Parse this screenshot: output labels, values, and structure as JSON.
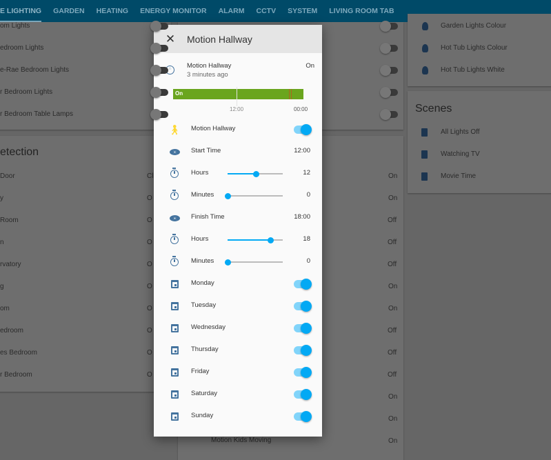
{
  "tabs": [
    "E LIGHTING",
    "GARDEN",
    "HEATING",
    "ENERGY MONITOR",
    "ALARM",
    "CCTV",
    "SYSTEM",
    "LIVING ROOM TAB"
  ],
  "left_card_lights": [
    "om Lights",
    "edroom Lights",
    "e-Rae Bedroom Lights",
    "r Bedroom Lights",
    "r Bedroom Table Lamps"
  ],
  "detection": {
    "title": "etection",
    "items": [
      {
        "name": "Door",
        "state": "Cl"
      },
      {
        "name": "y",
        "state": "O"
      },
      {
        "name": "Room",
        "state": "O"
      },
      {
        "name": "n",
        "state": "O"
      },
      {
        "name": "rvatory",
        "state": "O"
      },
      {
        "name": "g",
        "state": "O"
      },
      {
        "name": "om",
        "state": "O"
      },
      {
        "name": "edroom",
        "state": "O"
      },
      {
        "name": "es Bedroom",
        "state": "O"
      },
      {
        "name": "r Bedroom",
        "state": "O"
      }
    ]
  },
  "middle_states": [
    "On",
    "On",
    "Off",
    "Off",
    "Off",
    "On",
    "On",
    "Off",
    "Off",
    "Off",
    "On",
    "On"
  ],
  "middle_last": {
    "name": "Motion Kids Moving",
    "state": "On"
  },
  "right_lights": [
    "Garden Lights Colour",
    "Hot Tub Lights Colour",
    "Hot Tub Lights White"
  ],
  "scenes": {
    "title": "Scenes",
    "items": [
      "All Lights Off",
      "Watching TV",
      "Movie Time"
    ]
  },
  "dialog": {
    "title": "Motion Hallway",
    "entity": {
      "name": "Motion Hallway",
      "time": "3 minutes ago",
      "state": "On"
    },
    "history": {
      "bar_label": "On",
      "ticks": [
        "12:00",
        "00:00"
      ],
      "on_color": "#6aa51e"
    },
    "rows": [
      {
        "icon": "walk-icon",
        "label": "Motion Hallway",
        "type": "toggle",
        "on": true
      },
      {
        "icon": "eye-icon",
        "label": "Start Time",
        "type": "value",
        "value": "12:00"
      },
      {
        "icon": "timer-icon",
        "label": "Hours",
        "type": "slider",
        "value": "12",
        "fraction": 0.52
      },
      {
        "icon": "timer-icon",
        "label": "Minutes",
        "type": "slider",
        "value": "0",
        "fraction": 0
      },
      {
        "icon": "eye-icon",
        "label": "Finish Time",
        "type": "value",
        "value": "18:00"
      },
      {
        "icon": "timer-icon",
        "label": "Hours",
        "type": "slider",
        "value": "18",
        "fraction": 0.78
      },
      {
        "icon": "timer-icon",
        "label": "Minutes",
        "type": "slider",
        "value": "0",
        "fraction": 0
      },
      {
        "icon": "calendar-icon",
        "label": "Monday",
        "type": "toggle",
        "on": true
      },
      {
        "icon": "calendar-icon",
        "label": "Tuesday",
        "type": "toggle",
        "on": true
      },
      {
        "icon": "calendar-icon",
        "label": "Wednesday",
        "type": "toggle",
        "on": true
      },
      {
        "icon": "calendar-icon",
        "label": "Thursday",
        "type": "toggle",
        "on": true
      },
      {
        "icon": "calendar-icon",
        "label": "Friday",
        "type": "toggle",
        "on": true
      },
      {
        "icon": "calendar-icon",
        "label": "Saturday",
        "type": "toggle",
        "on": true
      },
      {
        "icon": "calendar-icon",
        "label": "Sunday",
        "type": "toggle",
        "on": true
      }
    ]
  }
}
